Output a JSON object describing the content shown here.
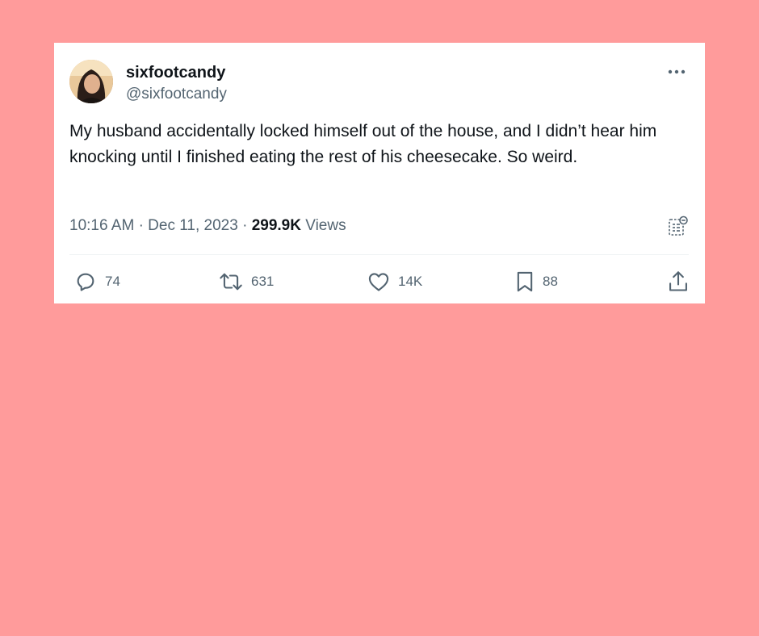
{
  "tweet": {
    "display_name": "sixfootcandy",
    "handle": "@sixfootcandy",
    "text": "My husband accidentally locked himself out of the house, and I didn’t hear him knocking until I finished eating the rest of his cheesecake. So weird.",
    "time": "10:16 AM",
    "separator": "·",
    "date": "Dec 11, 2023",
    "views_count": "299.9K",
    "views_label": "Views"
  },
  "actions": {
    "replies": "74",
    "retweets": "631",
    "likes": "14K",
    "bookmarks": "88"
  },
  "icons": {
    "more": "more-horizontal-icon",
    "analytics": "analytics-icon",
    "reply": "reply-icon",
    "retweet": "retweet-icon",
    "like": "heart-icon",
    "bookmark": "bookmark-icon",
    "share": "share-icon"
  },
  "colors": {
    "background": "#ff9b9b",
    "card": "#ffffff",
    "text_primary": "#0f1419",
    "text_secondary": "#536471"
  }
}
